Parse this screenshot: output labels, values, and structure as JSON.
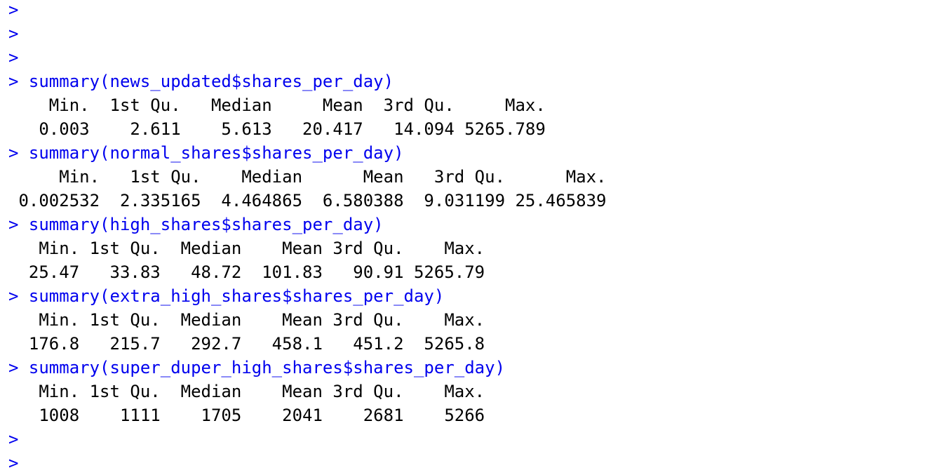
{
  "prompt_symbol": ">",
  "lines": [
    {
      "kind": "prompt",
      "text": ">"
    },
    {
      "kind": "prompt",
      "text": ">"
    },
    {
      "kind": "prompt",
      "text": ">"
    },
    {
      "kind": "command",
      "text": "> summary(news_updated$shares_per_day)"
    },
    {
      "kind": "output",
      "text": "    Min.  1st Qu.   Median     Mean  3rd Qu.     Max. "
    },
    {
      "kind": "output",
      "text": "   0.003    2.611    5.613   20.417   14.094 5265.789 "
    },
    {
      "kind": "command",
      "text": "> summary(normal_shares$shares_per_day)"
    },
    {
      "kind": "output",
      "text": "     Min.   1st Qu.    Median      Mean   3rd Qu.      Max. "
    },
    {
      "kind": "output",
      "text": " 0.002532  2.335165  4.464865  6.580388  9.031199 25.465839 "
    },
    {
      "kind": "command",
      "text": "> summary(high_shares$shares_per_day)"
    },
    {
      "kind": "output",
      "text": "   Min. 1st Qu.  Median    Mean 3rd Qu.    Max. "
    },
    {
      "kind": "output",
      "text": "  25.47   33.83   48.72  101.83   90.91 5265.79 "
    },
    {
      "kind": "command",
      "text": "> summary(extra_high_shares$shares_per_day)"
    },
    {
      "kind": "output",
      "text": "   Min. 1st Qu.  Median    Mean 3rd Qu.    Max. "
    },
    {
      "kind": "output",
      "text": "  176.8   215.7   292.7   458.1   451.2  5265.8 "
    },
    {
      "kind": "command",
      "text": "> summary(super_duper_high_shares$shares_per_day)"
    },
    {
      "kind": "output",
      "text": "   Min. 1st Qu.  Median    Mean 3rd Qu.    Max. "
    },
    {
      "kind": "output",
      "text": "   1008    1111    1705    2041    2681    5266 "
    },
    {
      "kind": "prompt",
      "text": ">"
    },
    {
      "kind": "prompt",
      "text": ">"
    }
  ],
  "colors": {
    "command": "#0000ee",
    "output": "#000000",
    "background": "#ffffff"
  }
}
